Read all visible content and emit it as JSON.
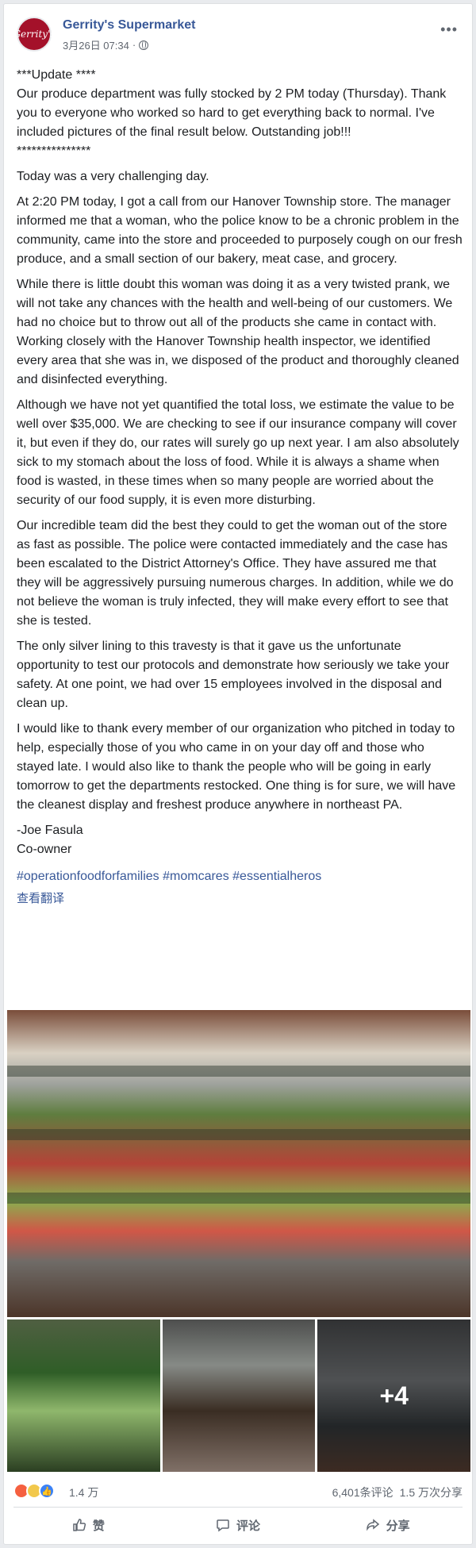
{
  "post": {
    "page_name": "Gerrity's Supermarket",
    "timestamp": "3月26日 07:34",
    "more_label": "•••",
    "avatar_text": "Gerrity's"
  },
  "body": {
    "p1": "***Update ****\nOur produce department was fully stocked by 2 PM today (Thursday). Thank you to everyone who worked so hard to get everything back to normal. I've included pictures of the final result below. Outstanding job!!!\n***************",
    "p2": "Today was a very challenging day.",
    "p3": "At 2:20 PM today, I got a call from our Hanover Township store. The manager informed me that a woman, who the police know to be a chronic problem in the community, came into the store and proceeded to purposely cough on our fresh produce, and a small section of our bakery, meat case, and grocery.",
    "p4": "While there is little doubt this woman was doing it as a very twisted prank, we will not take any chances with the health and well-being of our customers. We had no choice but to throw out all of the products she came in contact with. Working closely with the Hanover Township health inspector, we identified every area that she was in, we disposed of the product and thoroughly cleaned and disinfected everything.",
    "p5": "Although we have not yet quantified the total loss, we estimate the value to be well over $35,000. We are checking to see if our insurance company will cover it, but even if they do, our rates will surely go up next year. I am also absolutely sick to my stomach about the loss of food. While it is always a shame when food is wasted, in these times when so many people are worried about the security of our food supply, it is even more disturbing.",
    "p6": "Our incredible team did the best they could to get the woman out of the store as fast as possible. The police were contacted immediately and the case has been escalated to the District Attorney's Office. They have assured me that they will be aggressively pursuing numerous charges. In addition, while we do not believe the woman is truly infected, they will make every effort to see that she is tested.",
    "p7": "The only silver lining to this travesty is that it gave us the unfortunate opportunity to test our protocols and demonstrate how seriously we take your safety. At one point, we had over 15 employees involved in the disposal and clean up.",
    "p8": "I would like to thank every member of our organization who pitched in today to help, especially those of you who came in on your day off and those who stayed late. I would also like to thank the people who will be going in early tomorrow to get the departments restocked. One thing is for sure, we will have the cleanest display and freshest produce anywhere in northeast PA.",
    "p9": "-Joe Fasula\nCo-owner",
    "tag1": "#operationfoodforfamilies",
    "tag2": "#momcares",
    "tag3": "#essentialheros",
    "translate": "查看翻译"
  },
  "photos": {
    "more_count": "+4"
  },
  "stats": {
    "reactions": "1.4 万",
    "comments": "6,401条评论",
    "shares": "1.5 万次分享"
  },
  "actions": {
    "like": "赞",
    "comment": "评论",
    "share": "分享"
  }
}
